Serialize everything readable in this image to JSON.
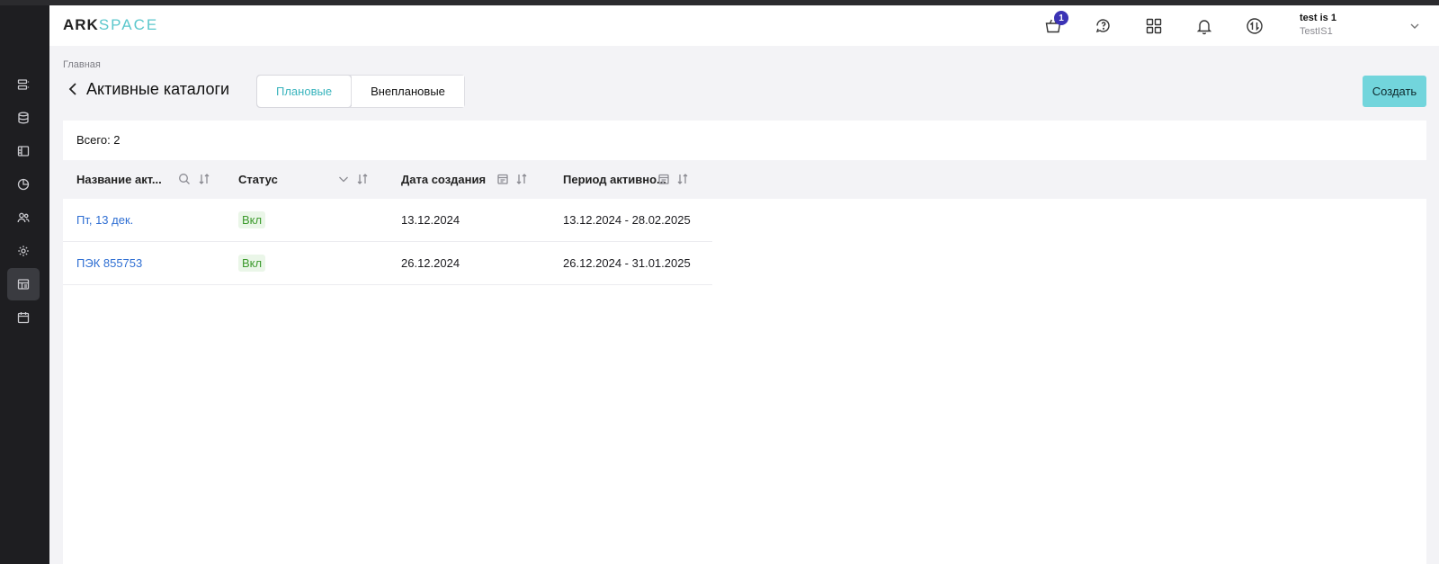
{
  "app": {
    "logo_part1": "ARK",
    "logo_part2": "SPACE",
    "accent_color": "#72d5dc",
    "link_color": "#2f6fd3"
  },
  "topbar": {
    "cart_badge": "1",
    "icons": [
      "cart-icon",
      "support-chat-icon",
      "apps-grid-icon",
      "bell-icon",
      "sync-icon"
    ],
    "user": {
      "name": "test is 1",
      "org": "TestIS1"
    }
  },
  "sidebar": {
    "items": [
      {
        "icon": "list-icon",
        "active": false
      },
      {
        "icon": "database-icon",
        "active": false
      },
      {
        "icon": "layout-icon",
        "active": false
      },
      {
        "icon": "pie-chart-icon",
        "active": false
      },
      {
        "icon": "users-icon",
        "active": false
      },
      {
        "icon": "settings-icon",
        "active": false
      },
      {
        "icon": "catalog-icon",
        "active": true
      },
      {
        "icon": "calendar-icon",
        "active": false
      }
    ]
  },
  "page": {
    "breadcrumb": "Главная",
    "title": "Активные каталоги",
    "tabs": [
      {
        "label": "Плановые",
        "active": true
      },
      {
        "label": "Внеплановые",
        "active": false
      }
    ],
    "create_label": "Создать"
  },
  "table": {
    "total": "Всего: 2",
    "columns": [
      "Название акт...",
      "Статус",
      "Дата создания",
      "Период активно..."
    ],
    "rows": [
      {
        "name": "Пт, 13 дек.",
        "status": "Вкл",
        "created": "13.12.2024",
        "period": "13.12.2024 - 28.02.2025"
      },
      {
        "name": "ПЭК 855753",
        "status": "Вкл",
        "created": "26.12.2024",
        "period": "26.12.2024 - 31.01.2025"
      }
    ]
  }
}
